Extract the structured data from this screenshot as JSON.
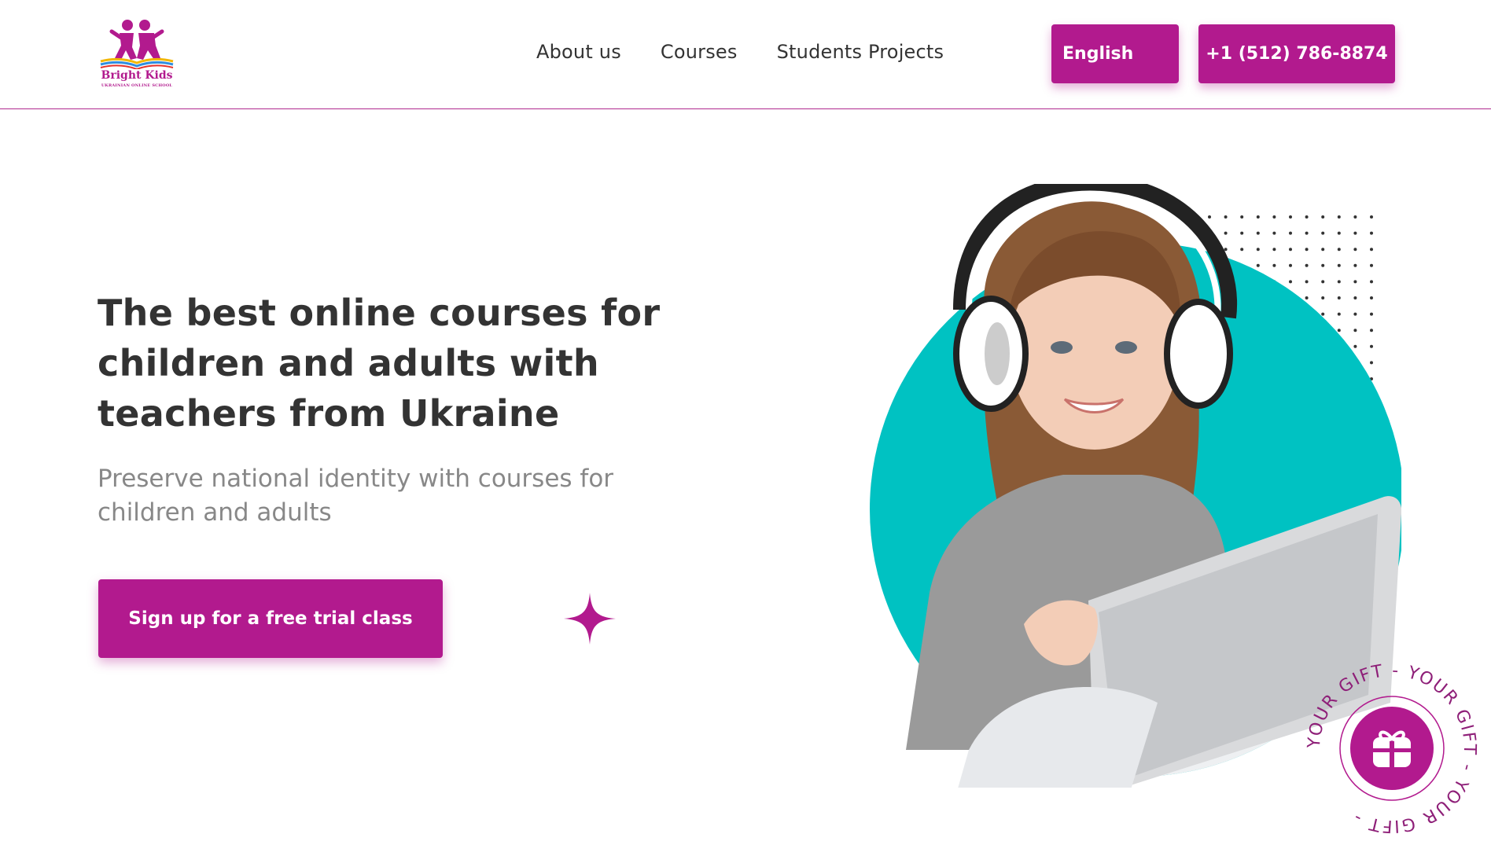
{
  "header": {
    "logo": {
      "title": "Bright Kids",
      "subtitle": "UKRAINIAN ONLINE SCHOOL"
    },
    "nav": [
      {
        "label": "About us"
      },
      {
        "label": "Courses"
      },
      {
        "label": "Students Projects"
      }
    ],
    "language_button": "English",
    "phone_button": "+1 (512) 786-8874"
  },
  "hero": {
    "title_lines": [
      "The best online courses for",
      "children and adults with",
      "teachers from Ukraine"
    ],
    "subtitle_lines": [
      "Preserve national identity with courses for",
      "children and adults"
    ],
    "cta_button": "Sign up for a free trial class"
  },
  "gift_badge": {
    "ring_text": "YOUR GIFT - YOUR GIFT - YOUR GIFT - "
  },
  "colors": {
    "brand": "#b21a8e",
    "teal": "#00c2c2",
    "text_dark": "#333333",
    "text_muted": "#888888"
  },
  "icons": {
    "sparkle": "sparkle-icon",
    "gift": "gift-icon",
    "logo": "children-book-logo-icon"
  }
}
